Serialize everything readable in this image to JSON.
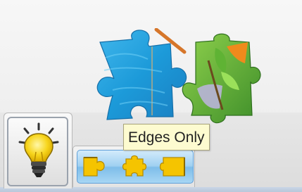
{
  "tooltip": {
    "text": "Edges Only"
  },
  "hint_button": {
    "icon": "lightbulb-icon"
  },
  "piece_filter": {
    "buttons": [
      {
        "icon": "edge-pieces-icon"
      },
      {
        "icon": "middle-pieces-icon"
      },
      {
        "icon": "corner-pieces-icon"
      }
    ]
  },
  "colors": {
    "accent_blue": "#7ebde9",
    "tooltip_background": "#fdfbd0",
    "piece_yellow": "#f5c400"
  }
}
